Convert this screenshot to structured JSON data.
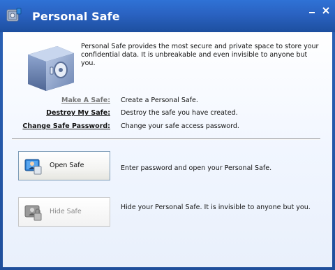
{
  "window": {
    "title": "Personal Safe",
    "icons": {
      "app": "safe-app-icon",
      "minimize": "minimize-icon",
      "close": "close-icon"
    }
  },
  "intro": {
    "description": "Personal Safe provides the most secure and private space to store your confidential data. It is unbreakable and even invisible to anyone but you.",
    "image": "safe-icon"
  },
  "actions": [
    {
      "label": "Make A Safe:",
      "description": "Create a Personal Safe.",
      "enabled": false
    },
    {
      "label": "Destroy My Safe:",
      "description": "Destroy the safe you have created.",
      "enabled": true
    },
    {
      "label": "Change Safe Password:",
      "description": "Change your safe access password.",
      "enabled": true
    }
  ],
  "buttons": {
    "open_safe": {
      "label": "Open Safe",
      "description": "Enter password and open your Personal Safe.",
      "icon": "person-screen-icon",
      "enabled": true
    },
    "hide_safe": {
      "label": "Hide Safe",
      "description": "Hide your Personal Safe. It is invisible to anyone but you.",
      "icon": "person-lock-icon",
      "enabled": false
    }
  },
  "colors": {
    "titlebar": "#2a62c1",
    "accent": "#7f9db9"
  }
}
